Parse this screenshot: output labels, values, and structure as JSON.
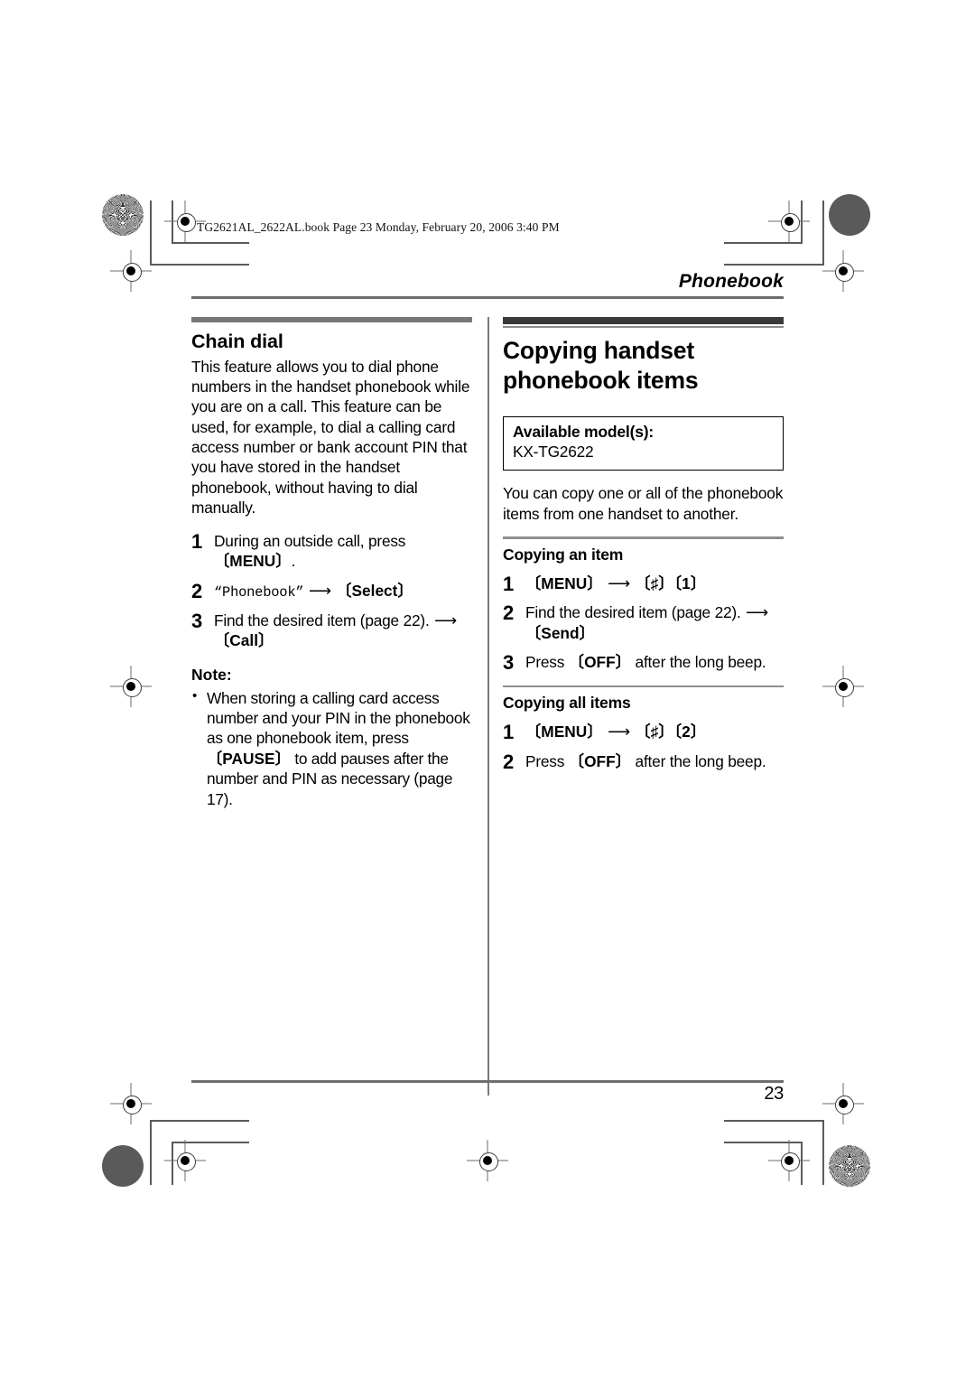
{
  "file_stamp": "TG2621AL_2622AL.book  Page 23  Monday, February 20, 2006  3:40 PM",
  "running_head": "Phonebook",
  "page_number": "23",
  "left_column": {
    "heading": "Chain dial",
    "intro": "This feature allows you to dial phone numbers in the handset phonebook while you are on a call. This feature can be used, for example, to dial a calling card access number or bank account PIN that you have stored in the handset phonebook, without having to dial manually.",
    "steps": [
      {
        "num": "1",
        "text_before": "During an outside call, press ",
        "key": "MENU",
        "text_after": "."
      },
      {
        "num": "2",
        "quoted_mono": "“Phonebook”",
        "arrow": "⟶",
        "key": "Select"
      },
      {
        "num": "3",
        "text_before": "Find the desired item (page 22). ",
        "arrow": "⟶",
        "key": "Call"
      }
    ],
    "note_heading": "Note:",
    "note_items": [
      {
        "part1": "When storing a calling card access number and your PIN in the phonebook as one phonebook item, press ",
        "key": "PAUSE",
        "part2": " to add pauses after the number and PIN as necessary (page 17)."
      }
    ]
  },
  "right_column": {
    "heading": "Copying handset phonebook items",
    "model_box": {
      "title": "Available model(s):",
      "value": "KX-TG2622"
    },
    "intro": "You can copy one or all of the phonebook items from one handset to another.",
    "sections": [
      {
        "subheading": "Copying an item",
        "steps": [
          {
            "num": "1",
            "key1": "MENU",
            "arrow": "⟶",
            "key2": "♯",
            "key3": "1"
          },
          {
            "num": "2",
            "text_before": "Find the desired item (page 22). ",
            "arrow": "⟶",
            "key": "Send"
          },
          {
            "num": "3",
            "text_before": "Press ",
            "key": "OFF",
            "text_after": " after the long beep."
          }
        ]
      },
      {
        "subheading": "Copying all items",
        "steps": [
          {
            "num": "1",
            "key1": "MENU",
            "arrow": "⟶",
            "key2": "♯",
            "key3": "2"
          },
          {
            "num": "2",
            "text_before": "Press ",
            "key": "OFF",
            "text_after": " after the long beep."
          }
        ]
      }
    ]
  },
  "bracket": {
    "open": "〔",
    "close": "〕"
  }
}
